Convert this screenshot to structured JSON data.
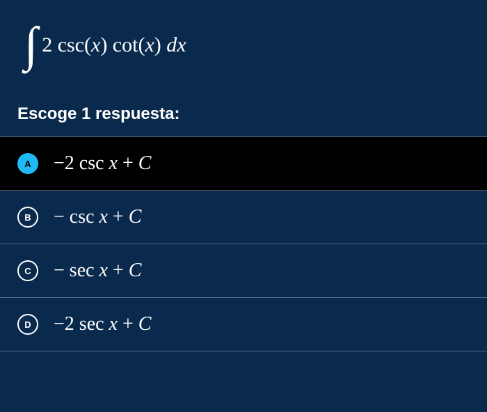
{
  "question": {
    "integral_html": "<span class=\"integral-sign\">∫</span><span>2 csc(<span class=\"math-var\">x</span>) cot(<span class=\"math-var\">x</span>)&nbsp;<span class=\"math-var\">dx</span></span>"
  },
  "prompt": "Escoge 1 respuesta:",
  "choices": [
    {
      "letter": "A",
      "html": "−2 csc <span class=\"math-var\">x</span> + <span class=\"math-var\">C</span>",
      "selected": true
    },
    {
      "letter": "B",
      "html": "− csc <span class=\"math-var\">x</span> + <span class=\"math-var\">C</span>",
      "selected": false
    },
    {
      "letter": "C",
      "html": "− sec <span class=\"math-var\">x</span> + <span class=\"math-var\">C</span>",
      "selected": false
    },
    {
      "letter": "D",
      "html": "−2 sec <span class=\"math-var\">x</span> + <span class=\"math-var\">C</span>",
      "selected": false
    }
  ]
}
